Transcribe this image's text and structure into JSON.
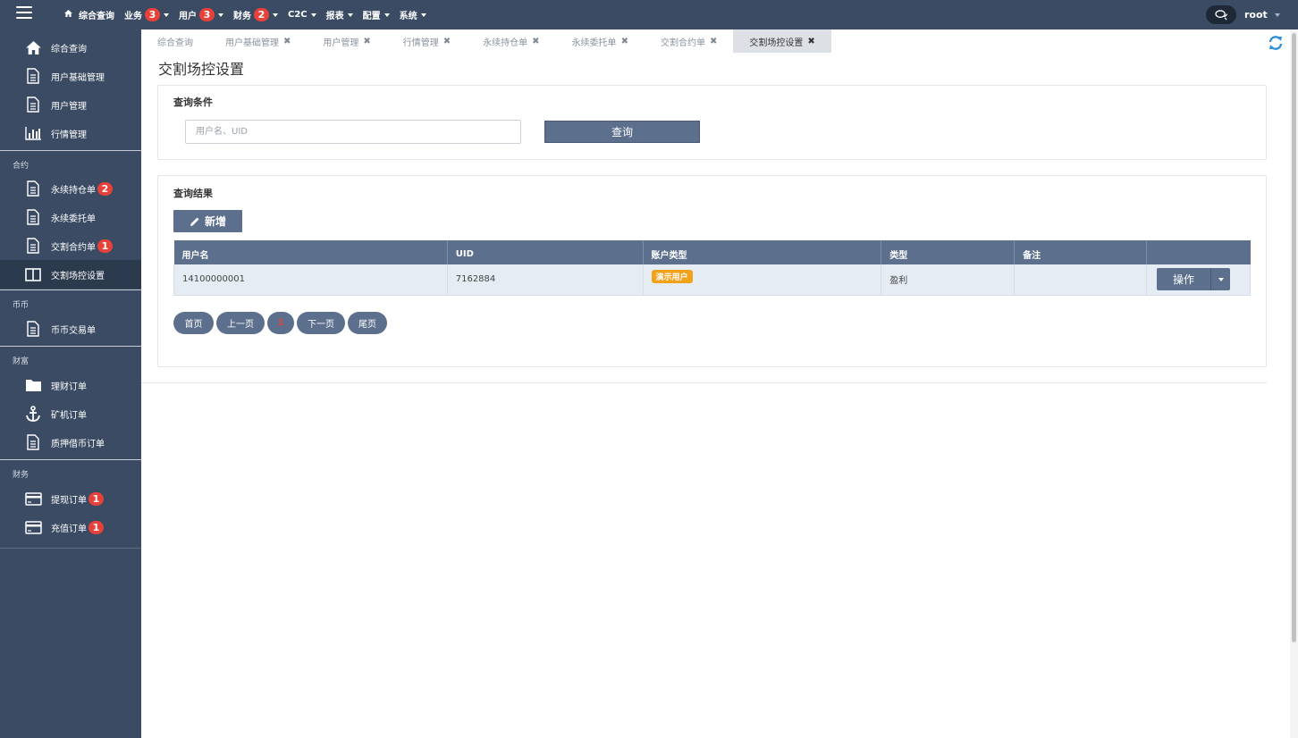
{
  "topnav": {
    "items": [
      {
        "label": "综合查询",
        "icon": "home-icon"
      },
      {
        "label": "业务",
        "badge": "3"
      },
      {
        "label": "用户",
        "badge": "3"
      },
      {
        "label": "财务",
        "badge": "2"
      },
      {
        "label": "C2C"
      },
      {
        "label": "报表"
      },
      {
        "label": "配置"
      },
      {
        "label": "系统"
      }
    ],
    "user": "root"
  },
  "sidebar": {
    "group0": [
      {
        "label": "综合查询",
        "icon": "home-icon"
      },
      {
        "label": "用户基础管理",
        "icon": "document-icon"
      },
      {
        "label": "用户管理",
        "icon": "document-icon"
      },
      {
        "label": "行情管理",
        "icon": "bar-chart-icon"
      }
    ],
    "group1": {
      "title": "合约",
      "items": [
        {
          "label": "永续持仓单",
          "badge": "2",
          "icon": "document-icon"
        },
        {
          "label": "永续委托单",
          "icon": "document-icon"
        },
        {
          "label": "交割合约单",
          "badge": "1",
          "icon": "document-icon"
        },
        {
          "label": "交割场控设置",
          "icon": "columns-icon"
        }
      ]
    },
    "group2": {
      "title": "币币",
      "items": [
        {
          "label": "币币交易单",
          "icon": "document-icon"
        }
      ]
    },
    "group3": {
      "title": "财富",
      "items": [
        {
          "label": "理财订单",
          "icon": "folder-icon"
        },
        {
          "label": "矿机订单",
          "icon": "anchor-icon"
        },
        {
          "label": "质押借币订单",
          "icon": "document-icon"
        }
      ]
    },
    "group4": {
      "title": "财务",
      "items": [
        {
          "label": "提现订单",
          "badge": "1",
          "icon": "credit-card-icon"
        },
        {
          "label": "充值订单",
          "badge": "1",
          "icon": "credit-card-icon"
        }
      ]
    }
  },
  "tabs": [
    "综合查询",
    "用户基础管理",
    "用户管理",
    "行情管理",
    "永续持仓单",
    "永续委托单",
    "交割合约单",
    "交割场控设置"
  ],
  "page": {
    "title": "交割场控设置"
  },
  "query": {
    "title": "查询条件",
    "placeholder": "用户名、UID",
    "button": "查询"
  },
  "results": {
    "title": "查询结果",
    "add_button": "新增",
    "columns": [
      "用户名",
      "UID",
      "账户类型",
      "类型",
      "备注",
      ""
    ],
    "rows": [
      {
        "username": "14100000001",
        "uid": "7162884",
        "account_type": "演示用户",
        "type": "盈利",
        "note": "",
        "action": "操作"
      }
    ]
  },
  "pager": {
    "first": "首页",
    "prev": "上一页",
    "current": "1",
    "next": "下一页",
    "last": "尾页"
  },
  "colors": {
    "nav_bg": "#3a4b63",
    "accent": "#5c6f8c",
    "badge": "#e8413a",
    "demo_badge": "#f0a21b",
    "refresh": "#2f8fd8"
  }
}
